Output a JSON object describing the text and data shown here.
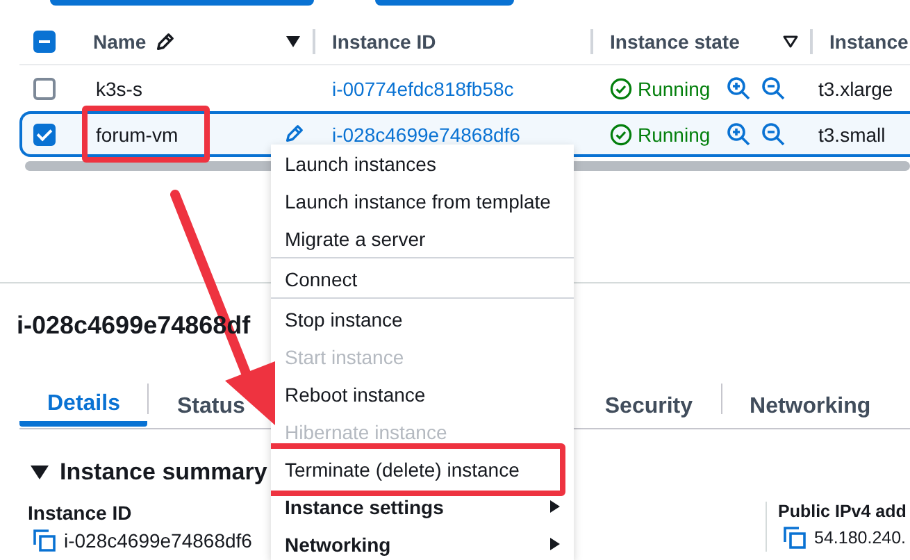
{
  "table": {
    "select_all_partial": true,
    "columns": [
      {
        "label": "Name",
        "kind": "editable"
      },
      {
        "label": "Instance ID",
        "kind": "plain"
      },
      {
        "label": "Instance state",
        "kind": "filter"
      },
      {
        "label": "Instance",
        "kind": "plain"
      }
    ],
    "rows": [
      {
        "name": "k3s-s",
        "instance_id": "i-00774efdc818fb58c",
        "state": "Running",
        "type": "t3.xlarge",
        "selected": false,
        "highlighted": false
      },
      {
        "name": "forum-vm",
        "instance_id": "i-028c4699e74868df6",
        "state": "Running",
        "type": "t3.small",
        "selected": true,
        "highlighted": true
      }
    ]
  },
  "menu": {
    "items": [
      {
        "kind": "item",
        "label": "Launch instances",
        "disabled": false,
        "highlighted": false
      },
      {
        "kind": "item",
        "label": "Launch instance from template",
        "disabled": false,
        "highlighted": false
      },
      {
        "kind": "item",
        "label": "Migrate a server",
        "disabled": false,
        "highlighted": false
      },
      {
        "kind": "divider"
      },
      {
        "kind": "item",
        "label": "Connect",
        "disabled": false,
        "highlighted": false
      },
      {
        "kind": "divider"
      },
      {
        "kind": "item",
        "label": "Stop instance",
        "disabled": false,
        "highlighted": false
      },
      {
        "kind": "item",
        "label": "Start instance",
        "disabled": true,
        "highlighted": false
      },
      {
        "kind": "item",
        "label": "Reboot instance",
        "disabled": false,
        "highlighted": false
      },
      {
        "kind": "item",
        "label": "Hibernate instance",
        "disabled": true,
        "highlighted": false
      },
      {
        "kind": "item",
        "label": "Terminate (delete) instance",
        "disabled": false,
        "highlighted": true
      },
      {
        "kind": "submenu",
        "label": "Instance settings",
        "disabled": false,
        "highlighted": false
      },
      {
        "kind": "submenu",
        "label": "Networking",
        "disabled": false,
        "highlighted": false
      }
    ]
  },
  "details": {
    "title": "i-028c4699e74868df",
    "tabs": [
      {
        "label": "Details",
        "selected": true
      },
      {
        "label": "Status",
        "selected": false
      },
      {
        "label": "Security",
        "selected": false
      },
      {
        "label": "Networking",
        "selected": false
      }
    ],
    "section": {
      "title": "Instance summary",
      "expanded": true
    },
    "fields": [
      {
        "label": "Instance ID",
        "value": "i-028c4699e74868df6"
      },
      {
        "label": "Public IPv4 add",
        "value": "54.180.240."
      }
    ]
  }
}
